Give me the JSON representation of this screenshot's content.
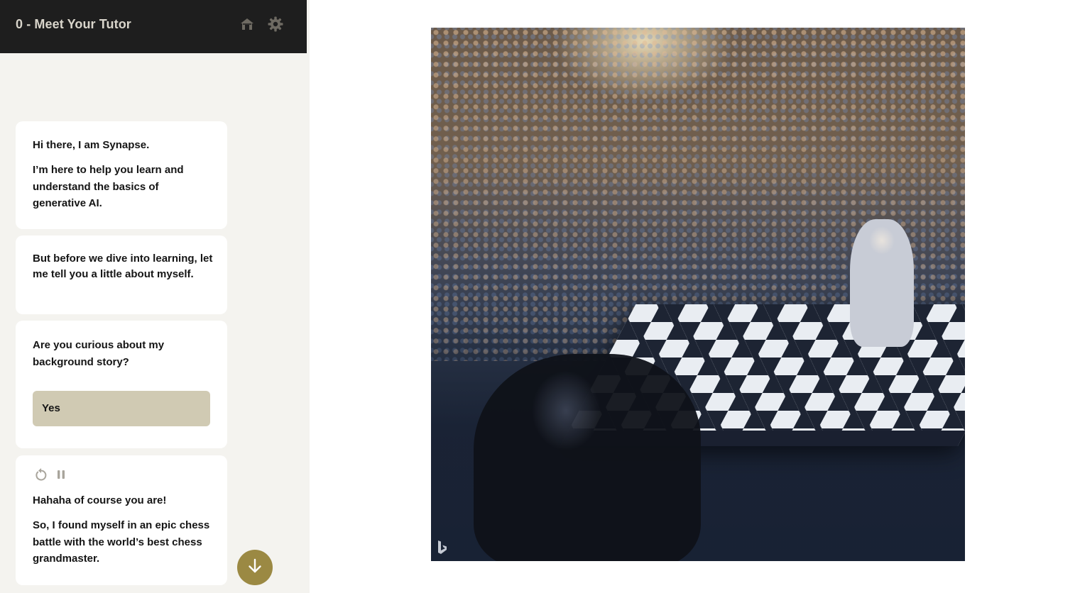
{
  "header": {
    "title": "0 - Meet Your Tutor",
    "icons": [
      "home-icon",
      "gear-icon"
    ]
  },
  "chat": {
    "card1": {
      "line1": "Hi there, I am Synapse.",
      "line2": "I’m here to help you learn and understand the basics of generative AI."
    },
    "card2": {
      "line1": "But before we dive into learning, let me tell you a little about myself."
    },
    "card3": {
      "question": "Are you curious about my background story?",
      "yes_label": "Yes"
    },
    "card4": {
      "controls": [
        "replay-icon",
        "pause-icon"
      ],
      "line1": "Hahaha of course you are!",
      "line2": "So, I found myself in an epic chess battle with the world’s best chess grandmaster."
    }
  },
  "colors": {
    "header_bg": "#1e1e1e",
    "sidebar_bg": "#f4f3ef",
    "card_bg": "#ffffff",
    "yes_button_bg": "#d0cab3",
    "scroll_button_bg": "#9b8943",
    "header_text": "#d9d5cb"
  },
  "scroll_button_icon": "arrow-down-icon"
}
